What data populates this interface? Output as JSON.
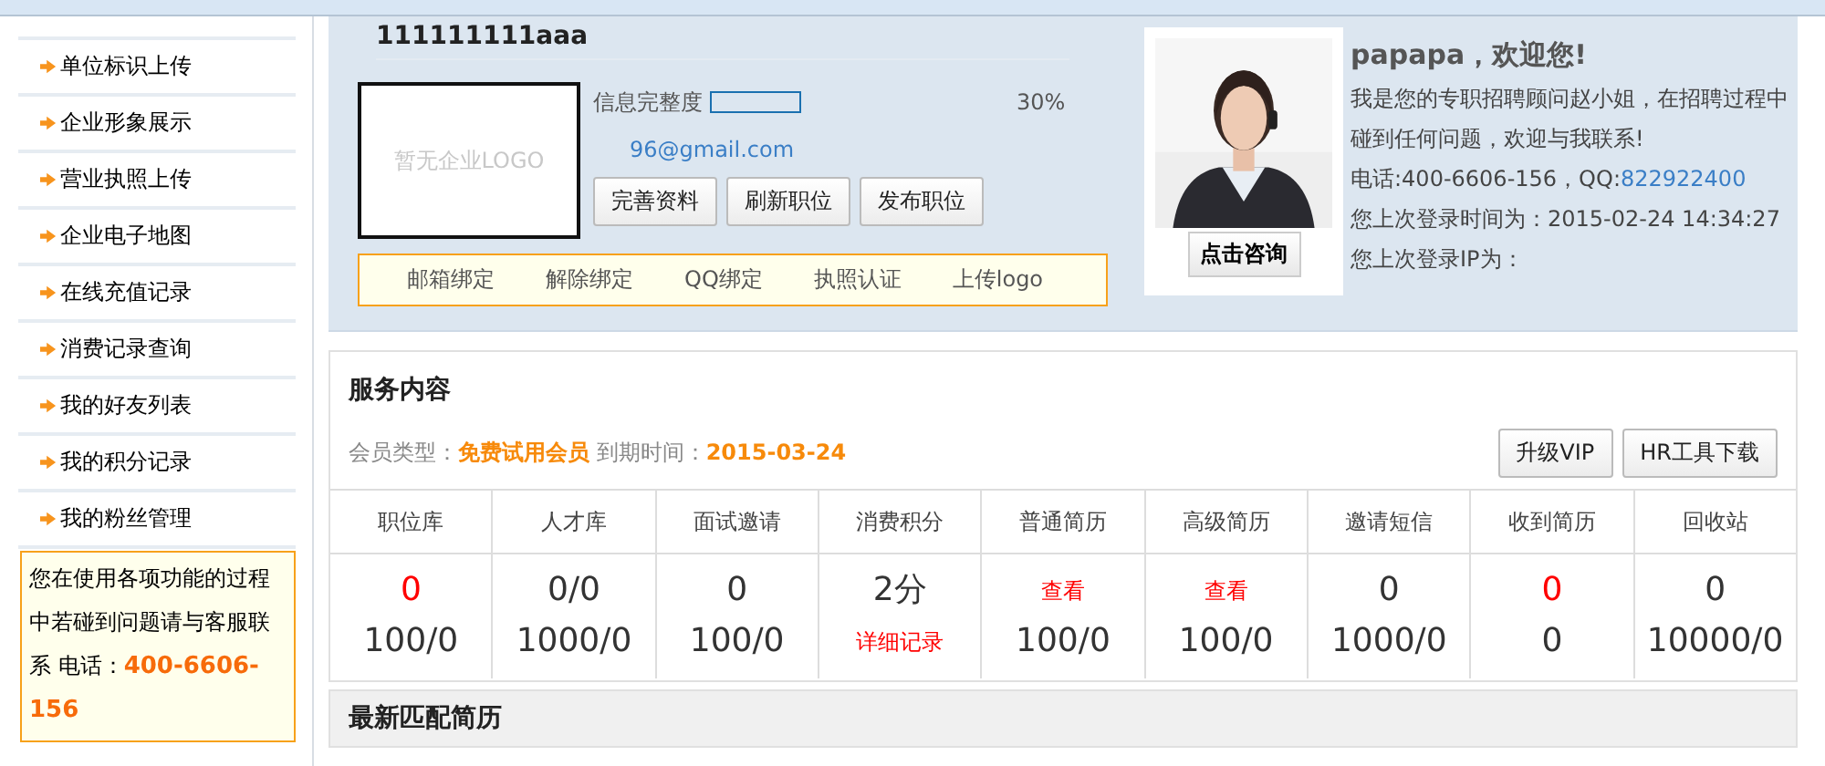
{
  "sidebar": {
    "items": [
      {
        "label": "单位标识上传"
      },
      {
        "label": "企业形象展示"
      },
      {
        "label": "营业执照上传"
      },
      {
        "label": "企业电子地图"
      },
      {
        "label": "在线充值记录"
      },
      {
        "label": "消费记录查询"
      },
      {
        "label": "我的好友列表"
      },
      {
        "label": "我的积分记录"
      },
      {
        "label": "我的粉丝管理"
      }
    ],
    "help": {
      "text": "您在使用各项功能的过程中若碰到问题请与客服联系 电话：",
      "phone": "400-6606-156"
    }
  },
  "profile": {
    "company": "111111111aaa",
    "logo_placeholder": "暂无企业LOGO",
    "completeness_label": "信息完整度",
    "completeness": {
      "level": 0
    },
    "percent": "30%",
    "email": "96@gmail.com",
    "buttons": [
      "完善资料",
      "刷新职位",
      "发布职位"
    ],
    "bind_links": [
      "邮箱绑定",
      "解除绑定",
      "QQ绑定",
      "执照认证",
      "上传logo"
    ]
  },
  "consultant": {
    "button": "点击咨询",
    "greeting": "papapa，欢迎您!",
    "intro": "我是您的专职招聘顾问赵小姐，在招聘过程中碰到任何问题，欢迎与我联系!",
    "phone": "电话:400-6606-156，QQ:",
    "qq": "822922400",
    "last_login_time": "您上次登录时间为：2015-02-24 14:34:27",
    "last_login_ip": "您上次登录IP为："
  },
  "service": {
    "title": "服务内容",
    "member_label": "会员类型：",
    "member_type": "免费试用会员",
    "expiry_label": "到期时间：",
    "expiry": "2015-03-24",
    "buttons": [
      "升级VIP",
      "HR工具下载"
    ],
    "columns": [
      {
        "header": "职位库",
        "lines": [
          {
            "text": "0",
            "kind": "alert"
          },
          {
            "text": "100/0",
            "kind": "value"
          }
        ]
      },
      {
        "header": "人才库",
        "lines": [
          {
            "text": "0/0",
            "kind": "value"
          },
          {
            "text": "1000/0",
            "kind": "value"
          }
        ]
      },
      {
        "header": "面试邀请",
        "lines": [
          {
            "text": "0",
            "kind": "value"
          },
          {
            "text": "100/0",
            "kind": "value"
          }
        ]
      },
      {
        "header": "消费积分",
        "lines": [
          {
            "text": "2分",
            "kind": "value"
          },
          {
            "text": "详细记录",
            "kind": "link"
          }
        ]
      },
      {
        "header": "普通简历",
        "lines": [
          {
            "text": "查看",
            "kind": "link"
          },
          {
            "text": "100/0",
            "kind": "value"
          }
        ]
      },
      {
        "header": "高级简历",
        "lines": [
          {
            "text": "查看",
            "kind": "link"
          },
          {
            "text": "100/0",
            "kind": "value"
          }
        ]
      },
      {
        "header": "邀请短信",
        "lines": [
          {
            "text": "0",
            "kind": "value"
          },
          {
            "text": "1000/0",
            "kind": "value"
          }
        ]
      },
      {
        "header": "收到简历",
        "lines": [
          {
            "text": "0",
            "kind": "alert"
          },
          {
            "text": "0",
            "kind": "value"
          }
        ]
      },
      {
        "header": "回收站",
        "lines": [
          {
            "text": "0",
            "kind": "value"
          },
          {
            "text": "10000/0",
            "kind": "value"
          }
        ]
      }
    ]
  },
  "latest": {
    "title": "最新匹配简历"
  }
}
